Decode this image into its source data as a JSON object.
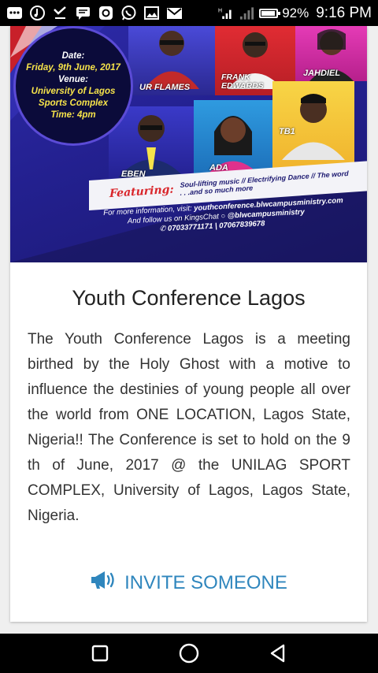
{
  "status_bar": {
    "battery_text": "92%",
    "battery_level": 0.92,
    "time": "9:16 PM",
    "notification_icons": [
      "bbm-icon",
      "music-icon",
      "download-check-icon",
      "chat-icon",
      "app-icon",
      "whatsapp-icon",
      "image-icon",
      "gmail-icon"
    ]
  },
  "banner": {
    "date_label": "Date:",
    "date_value": "Friday, 9th June, 2017",
    "venue_label": "Venue:",
    "venue_line1": "University of Lagos",
    "venue_line2": "Sports Complex",
    "time_line": "Time: 4pm",
    "performers": [
      "UR FLAMES",
      "FRANK EDWARDS",
      "JAHDIEL",
      "EBEN",
      "ADA",
      "TB1"
    ],
    "featuring_label": "Featuring:",
    "featuring_line1": "Soul-lifting music // Electrifying Dance // The word",
    "featuring_line2": ". . .and so much more",
    "info_prefix": "For more information, visit:",
    "info_url": "youthconference.blwcampusministry.com",
    "follow_prefix": "And follow us on KingsChat",
    "follow_handle": "@blwcampusministry",
    "phones": "07033771171 | 07067839678"
  },
  "content": {
    "title": "Youth Conference Lagos",
    "description": "The Youth Conference Lagos is a meeting birthed by the Holy Ghost with a motive to influence the destinies of young people all over the world from ONE LOCATION, Lagos State, Nigeria!! The Conference is set to hold on the 9 th of June, 2017 @ the UNILAG SPORT COMPLEX, University of Lagos, Lagos State, Nigeria.",
    "invite_label": "INVITE SOMEONE"
  },
  "colors": {
    "accent": "#2f86bd",
    "banner_blue": "#23208f",
    "banner_yellow": "#f6e34a",
    "banner_red": "#d9262b"
  }
}
